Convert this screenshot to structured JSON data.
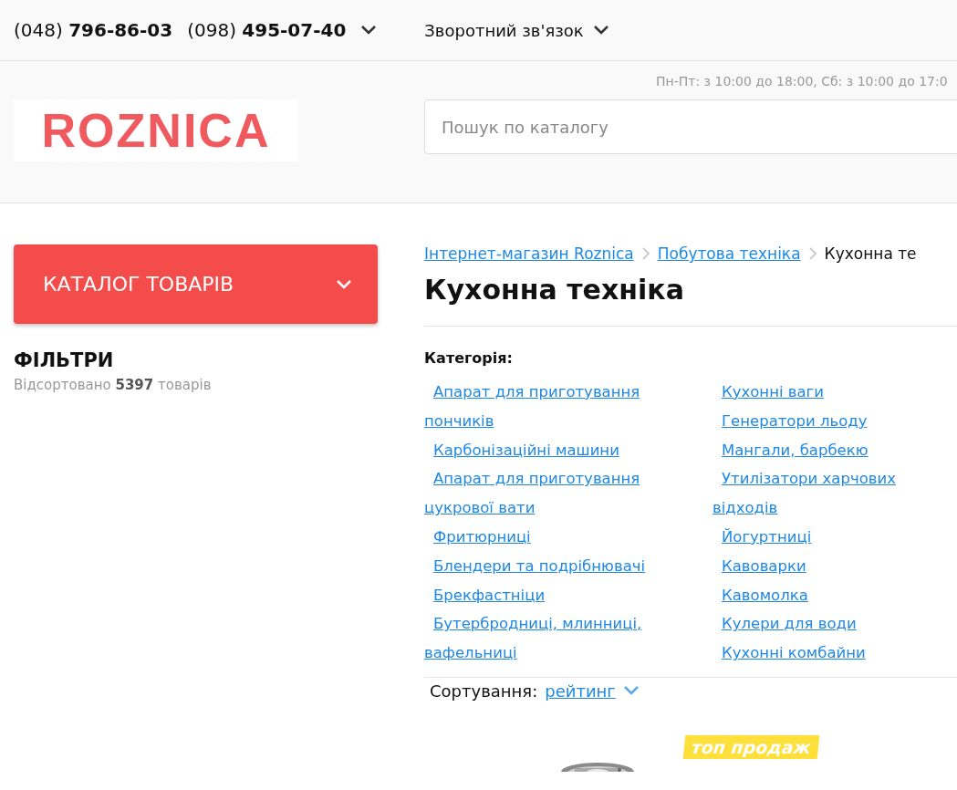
{
  "topbar": {
    "phones": [
      {
        "code": "(048)",
        "number": "796-86-03"
      },
      {
        "code": "(098)",
        "number": "495-07-40"
      }
    ],
    "feedback": "Зворотний зв'язок"
  },
  "header": {
    "hours": "Пн-Пт: з 10:00 до 18:00, Сб: з 10:00 до 17:0",
    "logo": "ROZNICA",
    "search": {
      "placeholder": "Пошук по каталогу"
    }
  },
  "sidebar": {
    "catalog_button": "КАТАЛОГ ТОВАРІВ",
    "filters_title": "ФІЛЬТРИ",
    "sorted_prefix": "Відсортовано",
    "sorted_count": "5397",
    "sorted_suffix": "товарів"
  },
  "breadcrumbs": [
    {
      "label": "Інтернет-магазин Roznica",
      "link": true
    },
    {
      "label": "Побутова техніка",
      "link": true
    },
    {
      "label": "Кухонна те",
      "link": false
    }
  ],
  "title": "Кухонна техніка",
  "categories": {
    "label": "Категорія:",
    "columns": [
      [
        "Апарат для приготування пончиків",
        "Карбонізаційні машини",
        "Апарат для приготування цукрової вати",
        "Фритюрниці",
        "Блендери та подрібнювачі",
        "Брекфастніци",
        "Бутербродниці, млинниці, вафельниці"
      ],
      [
        "Кухонні ваги",
        "Генератори льоду",
        "Мангали, барбекю",
        "Утилізатори харчових відходів",
        "Йогуртниці",
        "Кавоварки",
        "Кавомолка",
        "Кулери для води",
        "Кухонні комбайни"
      ]
    ]
  },
  "sort": {
    "label": "Сортування:",
    "value": "рейтинг"
  },
  "product": {
    "badge": "топ продаж"
  }
}
